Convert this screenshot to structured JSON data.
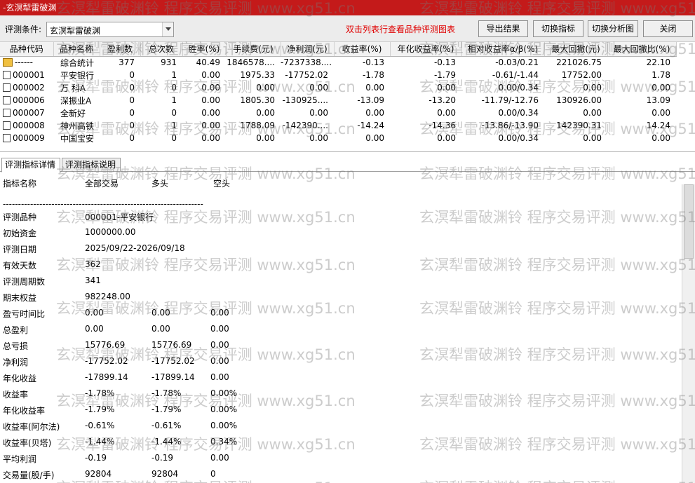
{
  "window": {
    "title": "-玄溟犁雷破渊"
  },
  "toolbar": {
    "condition_label": "评测条件:",
    "condition_value": "玄溟犁雷破渊",
    "hint": "双击列表行查看品种评测图表",
    "export_label": "导出结果",
    "switch_indicator_label": "切换指标",
    "switch_chart_label": "切换分析图",
    "close_label": "关闭"
  },
  "table": {
    "columns": [
      "品种代码",
      "品种名称",
      "盈利数",
      "总次数",
      "胜率(%)",
      "手续费(元)",
      "净利润(元)",
      "收益率(%)",
      "年化收益率(%)",
      "相对收益率α/β(%)",
      "最大回撤(元)",
      "最大回撤比(%)"
    ],
    "rows": [
      {
        "icon": "folder-icon",
        "cells": [
          "------",
          "综合统计",
          "377",
          "931",
          "40.49",
          "1846578....",
          "-7237338....",
          "-0.13",
          "-0.13",
          "-0.03/0.21",
          "221026.75",
          "22.10"
        ]
      },
      {
        "icon": "document-icon",
        "cells": [
          "000001",
          "平安银行",
          "0",
          "1",
          "0.00",
          "1975.33",
          "-17752.02",
          "-1.78",
          "-1.79",
          "-0.61/-1.44",
          "17752.00",
          "1.78"
        ]
      },
      {
        "icon": "document-icon",
        "cells": [
          "000002",
          "万 科A",
          "0",
          "0",
          "0.00",
          "0.00",
          "0.00",
          "0.00",
          "0.00",
          "0.00/0.34",
          "0.00",
          "0.00"
        ]
      },
      {
        "icon": "document-icon",
        "cells": [
          "000006",
          "深振业A",
          "0",
          "1",
          "0.00",
          "1805.30",
          "-130925....",
          "-13.09",
          "-13.20",
          "-11.79/-12.76",
          "130926.00",
          "13.09"
        ]
      },
      {
        "icon": "document-icon",
        "cells": [
          "000007",
          "全新好",
          "0",
          "0",
          "0.00",
          "0.00",
          "0.00",
          "0.00",
          "0.00",
          "0.00/0.34",
          "0.00",
          "0.00"
        ]
      },
      {
        "icon": "document-icon",
        "cells": [
          "000008",
          "神州高铁",
          "0",
          "1",
          "0.00",
          "1788.09",
          "-142390....",
          "-14.24",
          "-14.36",
          "-13.86/-13.90",
          "142390.31",
          "14.24"
        ]
      },
      {
        "icon": "document-icon",
        "cells": [
          "000009",
          "中国宝安",
          "0",
          "0",
          "0.00",
          "0.00",
          "0.00",
          "0.00",
          "0.00",
          "0.00/0.34",
          "0.00",
          "0.00"
        ]
      }
    ]
  },
  "tabs": [
    {
      "label": "评测指标详情",
      "active": true
    },
    {
      "label": "评测指标说明",
      "active": false
    }
  ],
  "detail": {
    "header": {
      "name": "指标名称",
      "all": "全部交易",
      "long": "多头",
      "short": "空头"
    },
    "separator": "------------------------------------------------------------------",
    "lines": [
      {
        "label": "评测品种",
        "v1": "000001-平安银行",
        "v2": "",
        "v3": ""
      },
      {
        "label": "初始资金",
        "v1": "1000000.00",
        "v2": "",
        "v3": ""
      },
      {
        "label": "评测日期",
        "v1": "2025/09/22-2026/09/18",
        "v2": "",
        "v3": ""
      },
      {
        "label": "有效天数",
        "v1": "362",
        "v2": "",
        "v3": ""
      },
      {
        "label": "评测周期数",
        "v1": "341",
        "v2": "",
        "v3": ""
      },
      {
        "label": "期末权益",
        "v1": "982248.00",
        "v2": "",
        "v3": ""
      },
      {
        "label": "盈亏时间比",
        "v1": "0.00",
        "v2": "0.00",
        "v3": "0.00"
      },
      {
        "label": "总盈利",
        "v1": "0.00",
        "v2": "0.00",
        "v3": "0.00"
      },
      {
        "label": "总亏损",
        "v1": "15776.69",
        "v2": "15776.69",
        "v3": "0.00"
      },
      {
        "label": "净利润",
        "v1": "-17752.02",
        "v2": "-17752.02",
        "v3": "0.00"
      },
      {
        "label": "年化收益",
        "v1": "-17899.14",
        "v2": "-17899.14",
        "v3": "0.00"
      },
      {
        "label": "收益率",
        "v1": "-1.78%",
        "v2": "-1.78%",
        "v3": "0.00%"
      },
      {
        "label": "年化收益率",
        "v1": "-1.79%",
        "v2": "-1.79%",
        "v3": "0.00%"
      },
      {
        "label": "收益率(阿尔法)",
        "v1": "-0.61%",
        "v2": "-0.61%",
        "v3": "0.00%"
      },
      {
        "label": "收益率(贝塔)",
        "v1": "-1.44%",
        "v2": "-1.44%",
        "v3": "0.34%"
      },
      {
        "label": "平均利润",
        "v1": "-0.19",
        "v2": "-0.19",
        "v3": "0.00"
      },
      {
        "label": "交易量(股/手)",
        "v1": "92804",
        "v2": "92804",
        "v3": "0"
      }
    ]
  },
  "watermark": {
    "text": "玄溟犁雷破渊铃 程序交易评测 www.xg51.cn"
  },
  "colors": {
    "title_bar": "#c41a1a",
    "hint_text": "#e00000",
    "watermark": "#787878"
  }
}
